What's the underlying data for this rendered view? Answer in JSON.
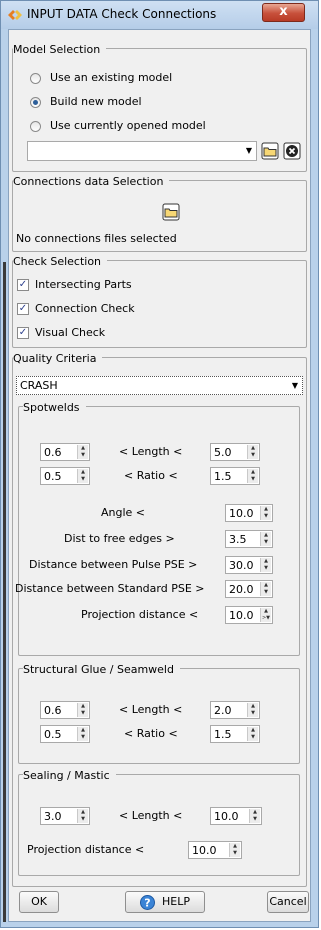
{
  "window": {
    "title": "INPUT DATA Check Connections",
    "close_glyph": "x"
  },
  "model_selection": {
    "title": "Model Selection",
    "options": [
      "Use an existing model",
      "Build new model",
      "Use currently opened model"
    ],
    "selected_index": 1,
    "model_combo_value": ""
  },
  "connections": {
    "title": "Connections data Selection",
    "status": "No connections files selected"
  },
  "check_selection": {
    "title": "Check Selection",
    "items": [
      {
        "label": "Intersecting Parts",
        "checked": true
      },
      {
        "label": "Connection Check",
        "checked": true
      },
      {
        "label": "Visual Check",
        "checked": true
      }
    ]
  },
  "quality": {
    "title": "Quality Criteria",
    "criteria_value": "CRASH",
    "spotwelds": {
      "title": "Spotwelds",
      "length_label": "< Length <",
      "length_min": "0.6",
      "length_max": "5.0",
      "ratio_label": "< Ratio <",
      "ratio_min": "0.5",
      "ratio_max": "1.5",
      "angle_label": "Angle <",
      "angle": "10.0",
      "free_edges_label": "Dist to free edges >",
      "free_edges": "3.5",
      "pulse_label": "Distance between Pulse PSE >",
      "pulse": "30.0",
      "standard_label": "Distance between Standard PSE >",
      "standard": "20.0",
      "projection_label": "Projection distance <",
      "projection": "10.0"
    },
    "glue": {
      "title": "Structural Glue / Seamweld",
      "length_label": "< Length <",
      "length_min": "0.6",
      "length_max": "2.0",
      "ratio_label": "< Ratio <",
      "ratio_min": "0.5",
      "ratio_max": "1.5"
    },
    "sealing": {
      "title": "Sealing / Mastic",
      "length_label": "< Length <",
      "length_min": "3.0",
      "length_max": "10.0",
      "projection_label": "Projection distance <",
      "projection": "10.0"
    }
  },
  "buttons": {
    "ok": "OK",
    "help": "HELP",
    "cancel": "Cancel"
  },
  "colors": {
    "window_frame": "#b9d1ea",
    "close_button": "#c7503b",
    "selected_radio": "#2d5f9a"
  },
  "icons": [
    "app-icon",
    "folder-icon",
    "clear-icon",
    "help-icon",
    "spin-arrows-icon"
  ]
}
